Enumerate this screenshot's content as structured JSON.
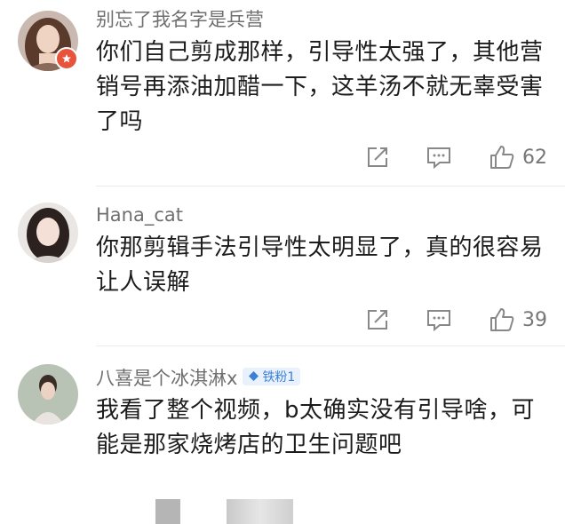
{
  "comments": [
    {
      "username": "别忘了我名字是兵营",
      "text": "你们自己剪成那样，引导性太强了，其他营销号再添油加醋一下，这羊汤不就无辜受害了吗",
      "likes": "62"
    },
    {
      "username": "Hana_cat",
      "text": "你那剪辑手法引导性太明显了，真的很容易让人误解",
      "likes": "39"
    },
    {
      "username": "八喜是个冰淇淋x",
      "badge": "铁粉1",
      "text": "我看了整个视频，b太确实没有引导啥，可能是那家烧烤店的卫生问题吧"
    }
  ],
  "icons": {
    "share": "share-icon",
    "comment": "comment-icon",
    "like": "thumbs-up-icon",
    "badge": "diamond-icon"
  }
}
